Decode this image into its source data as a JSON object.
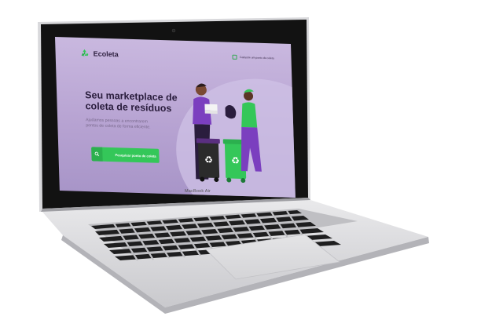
{
  "device": {
    "model_label": "MacBook Air"
  },
  "site": {
    "brand": {
      "name": "Ecoleta",
      "icon": "recycle-icon"
    },
    "nav": {
      "register_link_label": "Cadastre um ponto de coleta",
      "register_icon": "login-icon"
    },
    "hero": {
      "title": "Seu marketplace de coleta de resíduos",
      "subtitle": "Ajudamos pessoas a encontrarem pontos de coleta de forma eficiente.",
      "cta_label": "Pesquisar ponto de coleta",
      "cta_icon": "search-icon"
    },
    "colors": {
      "accent": "#34C759",
      "background": "#B9A6D4",
      "title": "#2A1D3D"
    }
  }
}
